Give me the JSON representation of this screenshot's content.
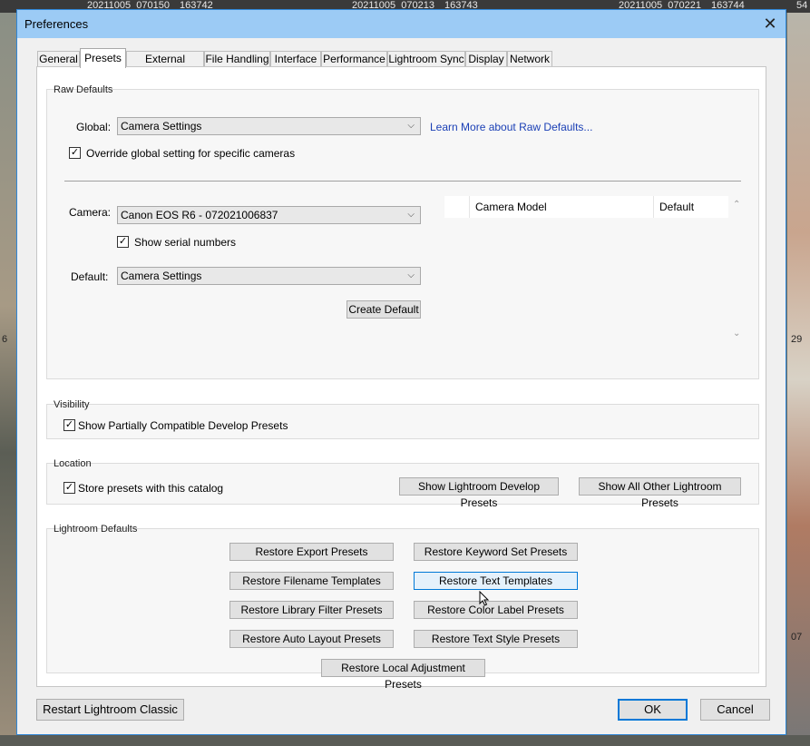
{
  "background": {
    "strip": [
      {
        "text": "20211005_070150"
      },
      {
        "text": "163742"
      },
      {
        "text": "20211005_070213"
      },
      {
        "text": "163743"
      },
      {
        "text": "20211005_070221"
      },
      {
        "text": "163744"
      },
      {
        "text": "54"
      }
    ],
    "side_left": [
      "6"
    ],
    "side_right": [
      "29",
      "07"
    ]
  },
  "dialog": {
    "title": "Preferences",
    "close_symbol": "✕"
  },
  "tabs": [
    {
      "label": "General"
    },
    {
      "label": "Presets",
      "active": true
    },
    {
      "label": "External Editing"
    },
    {
      "label": "File Handling"
    },
    {
      "label": "Interface"
    },
    {
      "label": "Performance"
    },
    {
      "label": "Lightroom Sync"
    },
    {
      "label": "Display"
    },
    {
      "label": "Network"
    }
  ],
  "raw_defaults": {
    "group_label": "Raw Defaults",
    "global_label": "Global:",
    "global_value": "Camera Settings",
    "learn_more": "Learn More about Raw Defaults...",
    "override_label": "Override global setting for specific cameras",
    "override_checked": true,
    "camera_label": "Camera:",
    "camera_value": "Canon EOS R6 - 072021006837",
    "serial_label": "Show serial numbers",
    "serial_checked": true,
    "default_label": "Default:",
    "default_value": "Camera Settings",
    "create_default": "Create Default",
    "table_headers": [
      "",
      "Camera Model",
      "Default"
    ]
  },
  "visibility": {
    "group_label": "Visibility",
    "show_partial_label": "Show Partially Compatible Develop Presets",
    "show_partial_checked": true
  },
  "location": {
    "group_label": "Location",
    "store_label": "Store presets with this catalog",
    "store_checked": true,
    "show_develop": "Show Lightroom Develop Presets",
    "show_other": "Show All Other Lightroom Presets"
  },
  "lightroom_defaults": {
    "group_label": "Lightroom Defaults",
    "buttons": [
      "Restore Export Presets",
      "Restore Keyword Set Presets",
      "Restore Filename Templates",
      "Restore Text Templates",
      "Restore Library Filter Presets",
      "Restore Color Label Presets",
      "Restore Auto Layout Presets",
      "Restore Text Style Presets",
      "Restore Local Adjustment Presets"
    ]
  },
  "footer": {
    "restart": "Restart Lightroom Classic",
    "ok": "OK",
    "cancel": "Cancel"
  },
  "colors": {
    "accent": "#0078d7",
    "titlebar": "#9ccbf5",
    "link": "#1a3fb5"
  },
  "icons": {
    "dropdown": "chevron-down-icon",
    "check": "check-icon",
    "close": "close-icon",
    "scroll_up": "chevron-up-icon",
    "scroll_down": "chevron-down-icon"
  }
}
